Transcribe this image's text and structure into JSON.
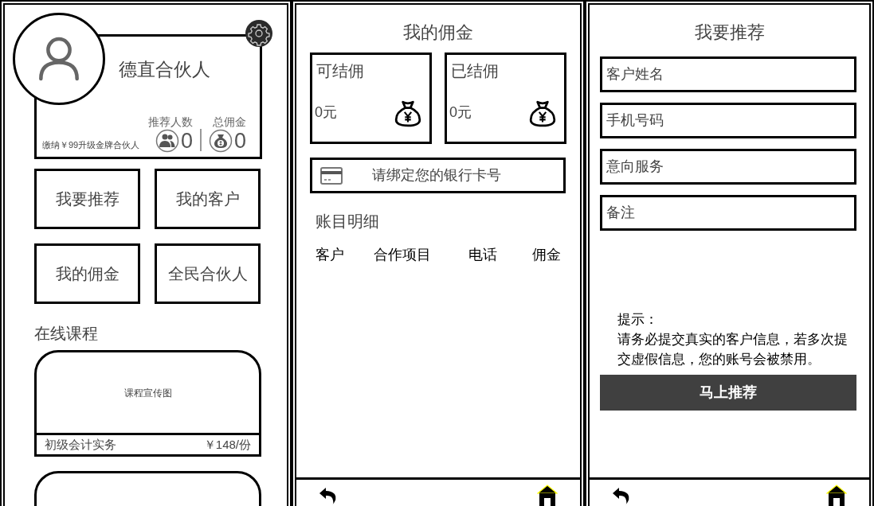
{
  "home": {
    "profile": {
      "name": "德直合伙人",
      "upgrade_note": "缴纳￥99升级金牌合伙人",
      "stats": [
        {
          "kind": "people",
          "label": "推荐人数",
          "value": "0"
        },
        {
          "kind": "money",
          "label": "总佣金",
          "value": "0"
        }
      ]
    },
    "menu": [
      "我要推荐",
      "我的客户",
      "我的佣金",
      "全民合伙人"
    ],
    "section_title": "在线课程",
    "courses": [
      {
        "kind": "full",
        "image_label": "课程宣传图",
        "title": "初级会计实务",
        "price": "￥148/份"
      },
      {
        "kind": "partial"
      }
    ]
  },
  "commission": {
    "title": "我的佣金",
    "balances": [
      {
        "label": "可结佣",
        "amount": "0元"
      },
      {
        "label": "已结佣",
        "amount": "0元"
      }
    ],
    "bank_prompt": "请绑定您的银行卡号",
    "ledger_title": "账目明细",
    "columns": [
      "客户",
      "合作项目",
      "电话",
      "佣金"
    ]
  },
  "recommend": {
    "title": "我要推荐",
    "fields": [
      {
        "placeholder": "客户姓名"
      },
      {
        "placeholder": "手机号码"
      },
      {
        "placeholder": "意向服务"
      },
      {
        "placeholder": "备注"
      }
    ],
    "tip_title": "提示：",
    "tip_text": "请务必提交真实的客户信息，若多次提交虚假信息，您的账号会被禁用。",
    "submit": "马上推荐"
  }
}
